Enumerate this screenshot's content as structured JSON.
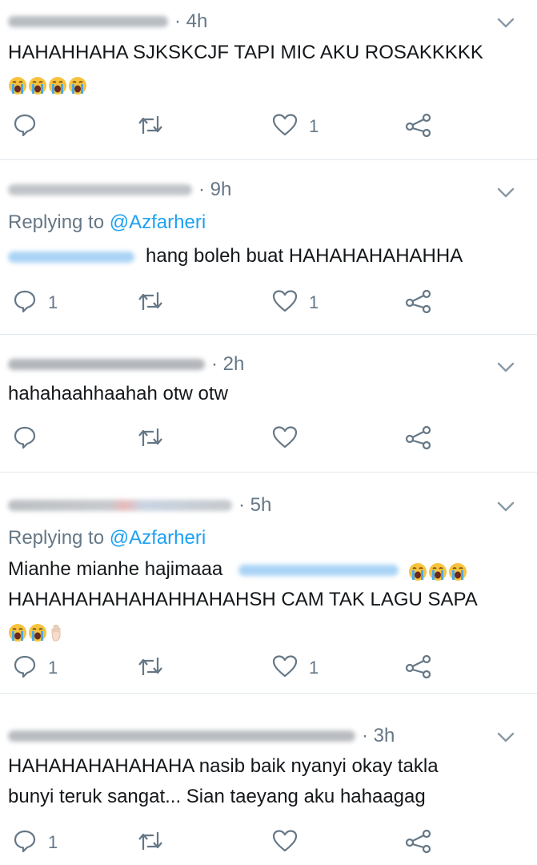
{
  "tweets": [
    {
      "time": "· 4h",
      "reply_to": null,
      "lines": [
        "HAHAHHAHA SJKSKCJF TAPI MIC AKU ROSAKKKKK"
      ],
      "emoji_line": [
        "loudly-crying-face",
        "loudly-crying-face",
        "loudly-crying-face",
        "loudly-crying-face"
      ],
      "reply_count": "",
      "retweet_count": "",
      "like_count": "1"
    },
    {
      "time": "· 9h",
      "reply_to": {
        "prefix": "Replying to",
        "handle": "@Azfarheri"
      },
      "lines": [
        "hang boleh buat HAHAHAHAHAHHA"
      ],
      "reply_count": "1",
      "retweet_count": "",
      "like_count": "1"
    },
    {
      "time": "· 2h",
      "reply_to": null,
      "lines": [
        "hahahaahhaahah otw otw"
      ],
      "reply_count": "",
      "retweet_count": "",
      "like_count": ""
    },
    {
      "time": "· 5h",
      "reply_to": {
        "prefix": "Replying to",
        "handle": "@Azfarheri"
      },
      "lines": [
        "Mianhe mianhe hajimaaa",
        "HAHAHAHAHAHAHHAHAHSH CAM TAK LAGU SAPA"
      ],
      "emoji_after_line1": [
        "loudly-crying-face",
        "loudly-crying-face",
        "loudly-crying-face"
      ],
      "emoji_line": [
        "loudly-crying-face",
        "loudly-crying-face",
        "raised-hand"
      ],
      "reply_count": "1",
      "retweet_count": "",
      "like_count": "1"
    },
    {
      "time": "· 3h",
      "reply_to": null,
      "lines": [
        "HAHAHAHAHAHAHA nasib baik nyanyi okay takla",
        "bunyi teruk sangat... Sian taeyang aku hahaagag"
      ],
      "reply_count": "1",
      "retweet_count": "",
      "like_count": ""
    }
  ],
  "colors": {
    "text": "#14171a",
    "muted": "#657786",
    "link": "#1da1f2",
    "divider": "#e1e8ed",
    "icon": "#657786"
  },
  "icons": {
    "reply": "speech-bubble-icon",
    "retweet": "retweet-icon",
    "like": "heart-icon",
    "share": "share-icon",
    "more": "chevron-down-icon"
  }
}
